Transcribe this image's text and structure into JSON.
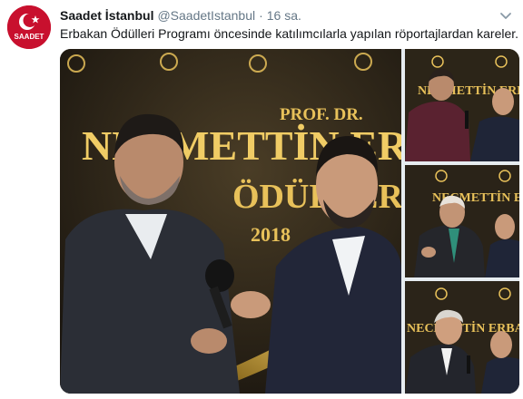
{
  "tweet": {
    "display_name": "Saadet İstanbul",
    "handle": "@SaadetIstanbul",
    "separator": "·",
    "time": "16 sa.",
    "text": "Erbakan Ödülleri Programı öncesinde katılımcılarla yapılan röportajlardan kareler.",
    "avatar_text": "SAADET"
  },
  "backdrop": {
    "line1": "PROF. DR.",
    "line2": "NECMETTİN ERBAKAN",
    "line3": "ÖDÜLLERİ",
    "year": "2018",
    "logo_small": "ERBAKAN"
  },
  "colors": {
    "brand_red": "#c8102e",
    "gold": "#e8c15a",
    "dark_bg": "#231d14"
  },
  "icons": {
    "menu": "chevron-down-icon",
    "avatar_emblem": "crescent-star-icon"
  }
}
